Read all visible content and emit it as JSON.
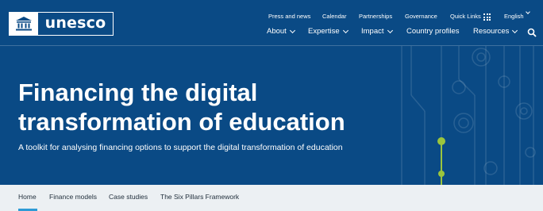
{
  "brand": {
    "logo_text": "unesco",
    "logo_icon": "temple-icon"
  },
  "utility_nav": {
    "items": [
      "Press and news",
      "Calendar",
      "Partnerships",
      "Governance",
      "Quick Links"
    ],
    "quick_links_icon": "grid-icon",
    "language": "English"
  },
  "main_nav": {
    "items": [
      {
        "label": "About",
        "has_dropdown": true
      },
      {
        "label": "Expertise",
        "has_dropdown": true
      },
      {
        "label": "Impact",
        "has_dropdown": true
      },
      {
        "label": "Country profiles",
        "has_dropdown": false
      },
      {
        "label": "Resources",
        "has_dropdown": true
      }
    ],
    "search_icon": "search-icon"
  },
  "hero": {
    "title": "Financing the digital transformation of education",
    "subtitle": "A toolkit for analysing financing options to support the digital transformation of education"
  },
  "subnav": {
    "tabs": [
      "Home",
      "Finance models",
      "Case studies",
      "The Six Pillars Framework"
    ],
    "active_tab": "Home"
  },
  "colors": {
    "hero_background": "#0a4a85",
    "subnav_background": "#ecf0f3",
    "active_indicator": "#2e9bd6",
    "accent_dot": "#9bc53d"
  }
}
